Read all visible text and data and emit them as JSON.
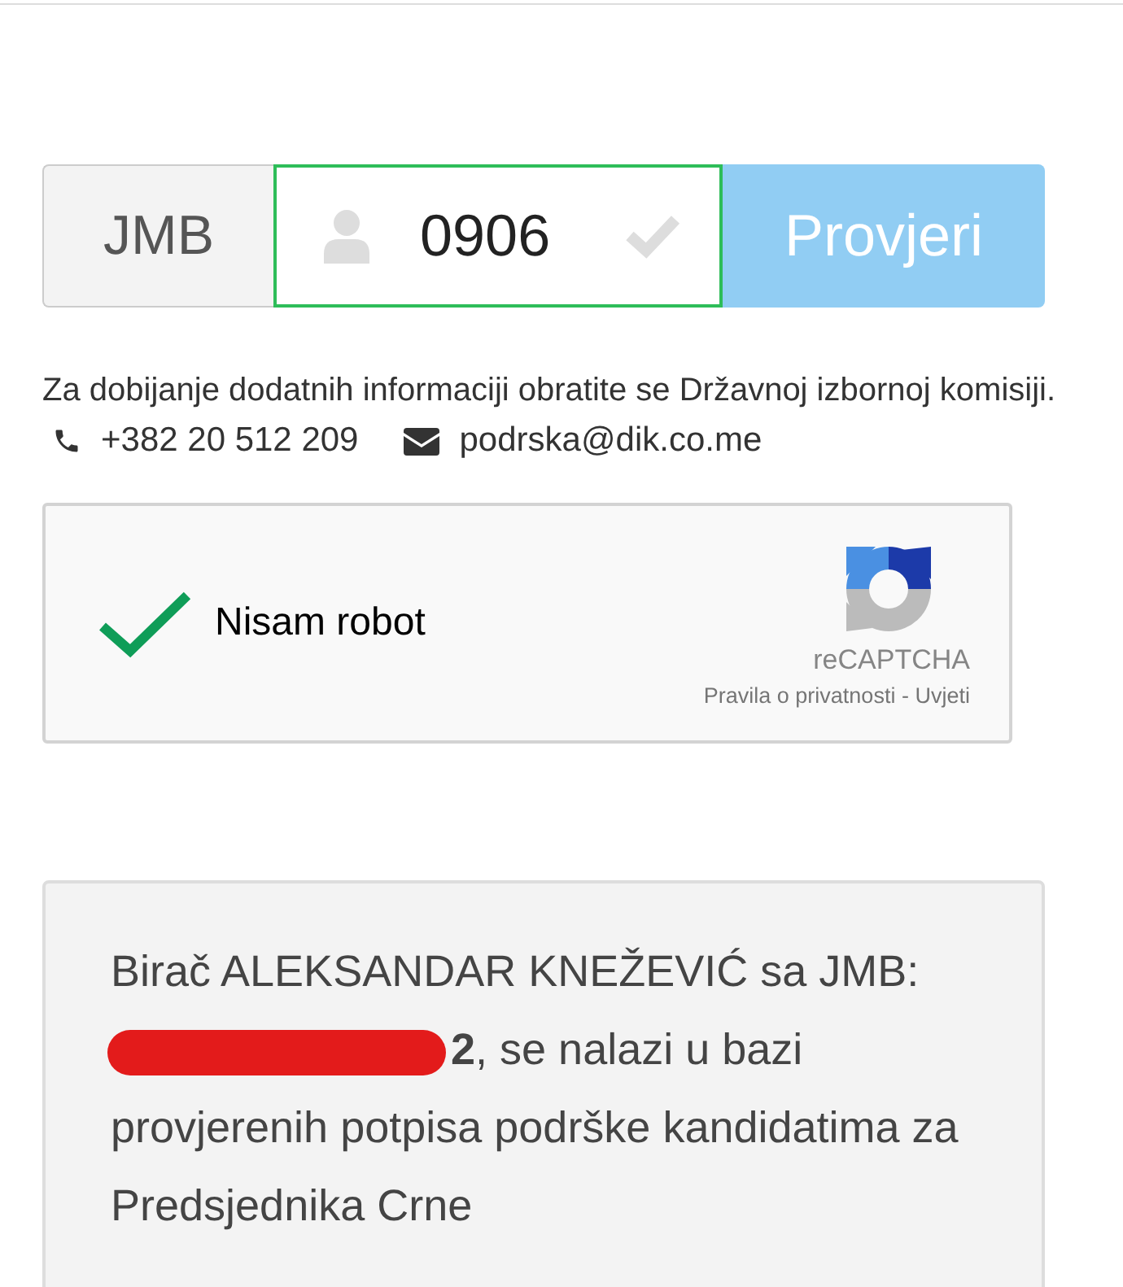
{
  "form": {
    "prefix": "JMB",
    "value": "0906",
    "button": "Provjeri",
    "valid": true
  },
  "info": {
    "text": "Za dobijanje dodatnih informaciji obratite se Državnoj izbornoj komisiji.",
    "phone": "+382 20 512 209",
    "email": "podrska@dik.co.me"
  },
  "captcha": {
    "label": "Nisam robot",
    "checked": true,
    "brand": "reCAPTCHA",
    "privacy": "Pravila o privatnosti",
    "separator": "-",
    "terms": "Uvjeti"
  },
  "result": {
    "before": "Birač ALEKSANDAR KNEŽEVIĆ sa JMB:",
    "redacted": true,
    "after": "**2**, se nalazi u bazi provjerenih potpisa podrške kandidatima za Predsjednika Crne"
  }
}
